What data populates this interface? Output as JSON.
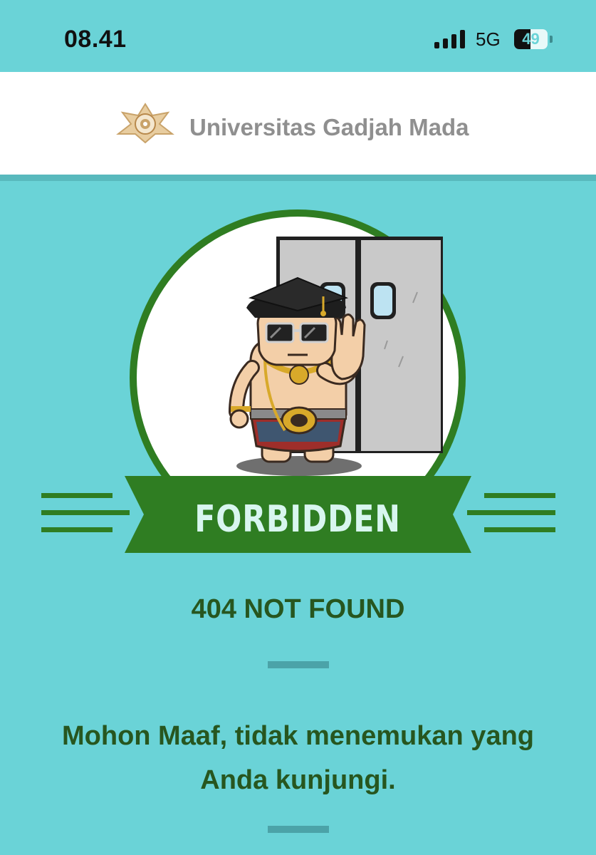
{
  "status_bar": {
    "time": "08.41",
    "network": "5G",
    "battery_level": "49",
    "battery_fraction": 0.49,
    "icons": [
      "signal-icon",
      "battery-icon"
    ]
  },
  "header": {
    "logo_icon": "ugm-emblem-logo",
    "title": "Universitas Gadjah Mada"
  },
  "illustration": {
    "banner_text": "FORBIDDEN",
    "description_icon": "mascot-stop-gesture-illustration"
  },
  "content": {
    "error_code": "404 NOT FOUND",
    "message": "Mohon Maaf, tidak menemukan yang Anda kunjungi."
  },
  "colors": {
    "background": "#6ad3d7",
    "header_background": "#ffffff",
    "primary_green": "#2f7d22",
    "text_green": "#27561f",
    "banner_text": "#d8f6ef",
    "divider": "#4ba3a8"
  }
}
